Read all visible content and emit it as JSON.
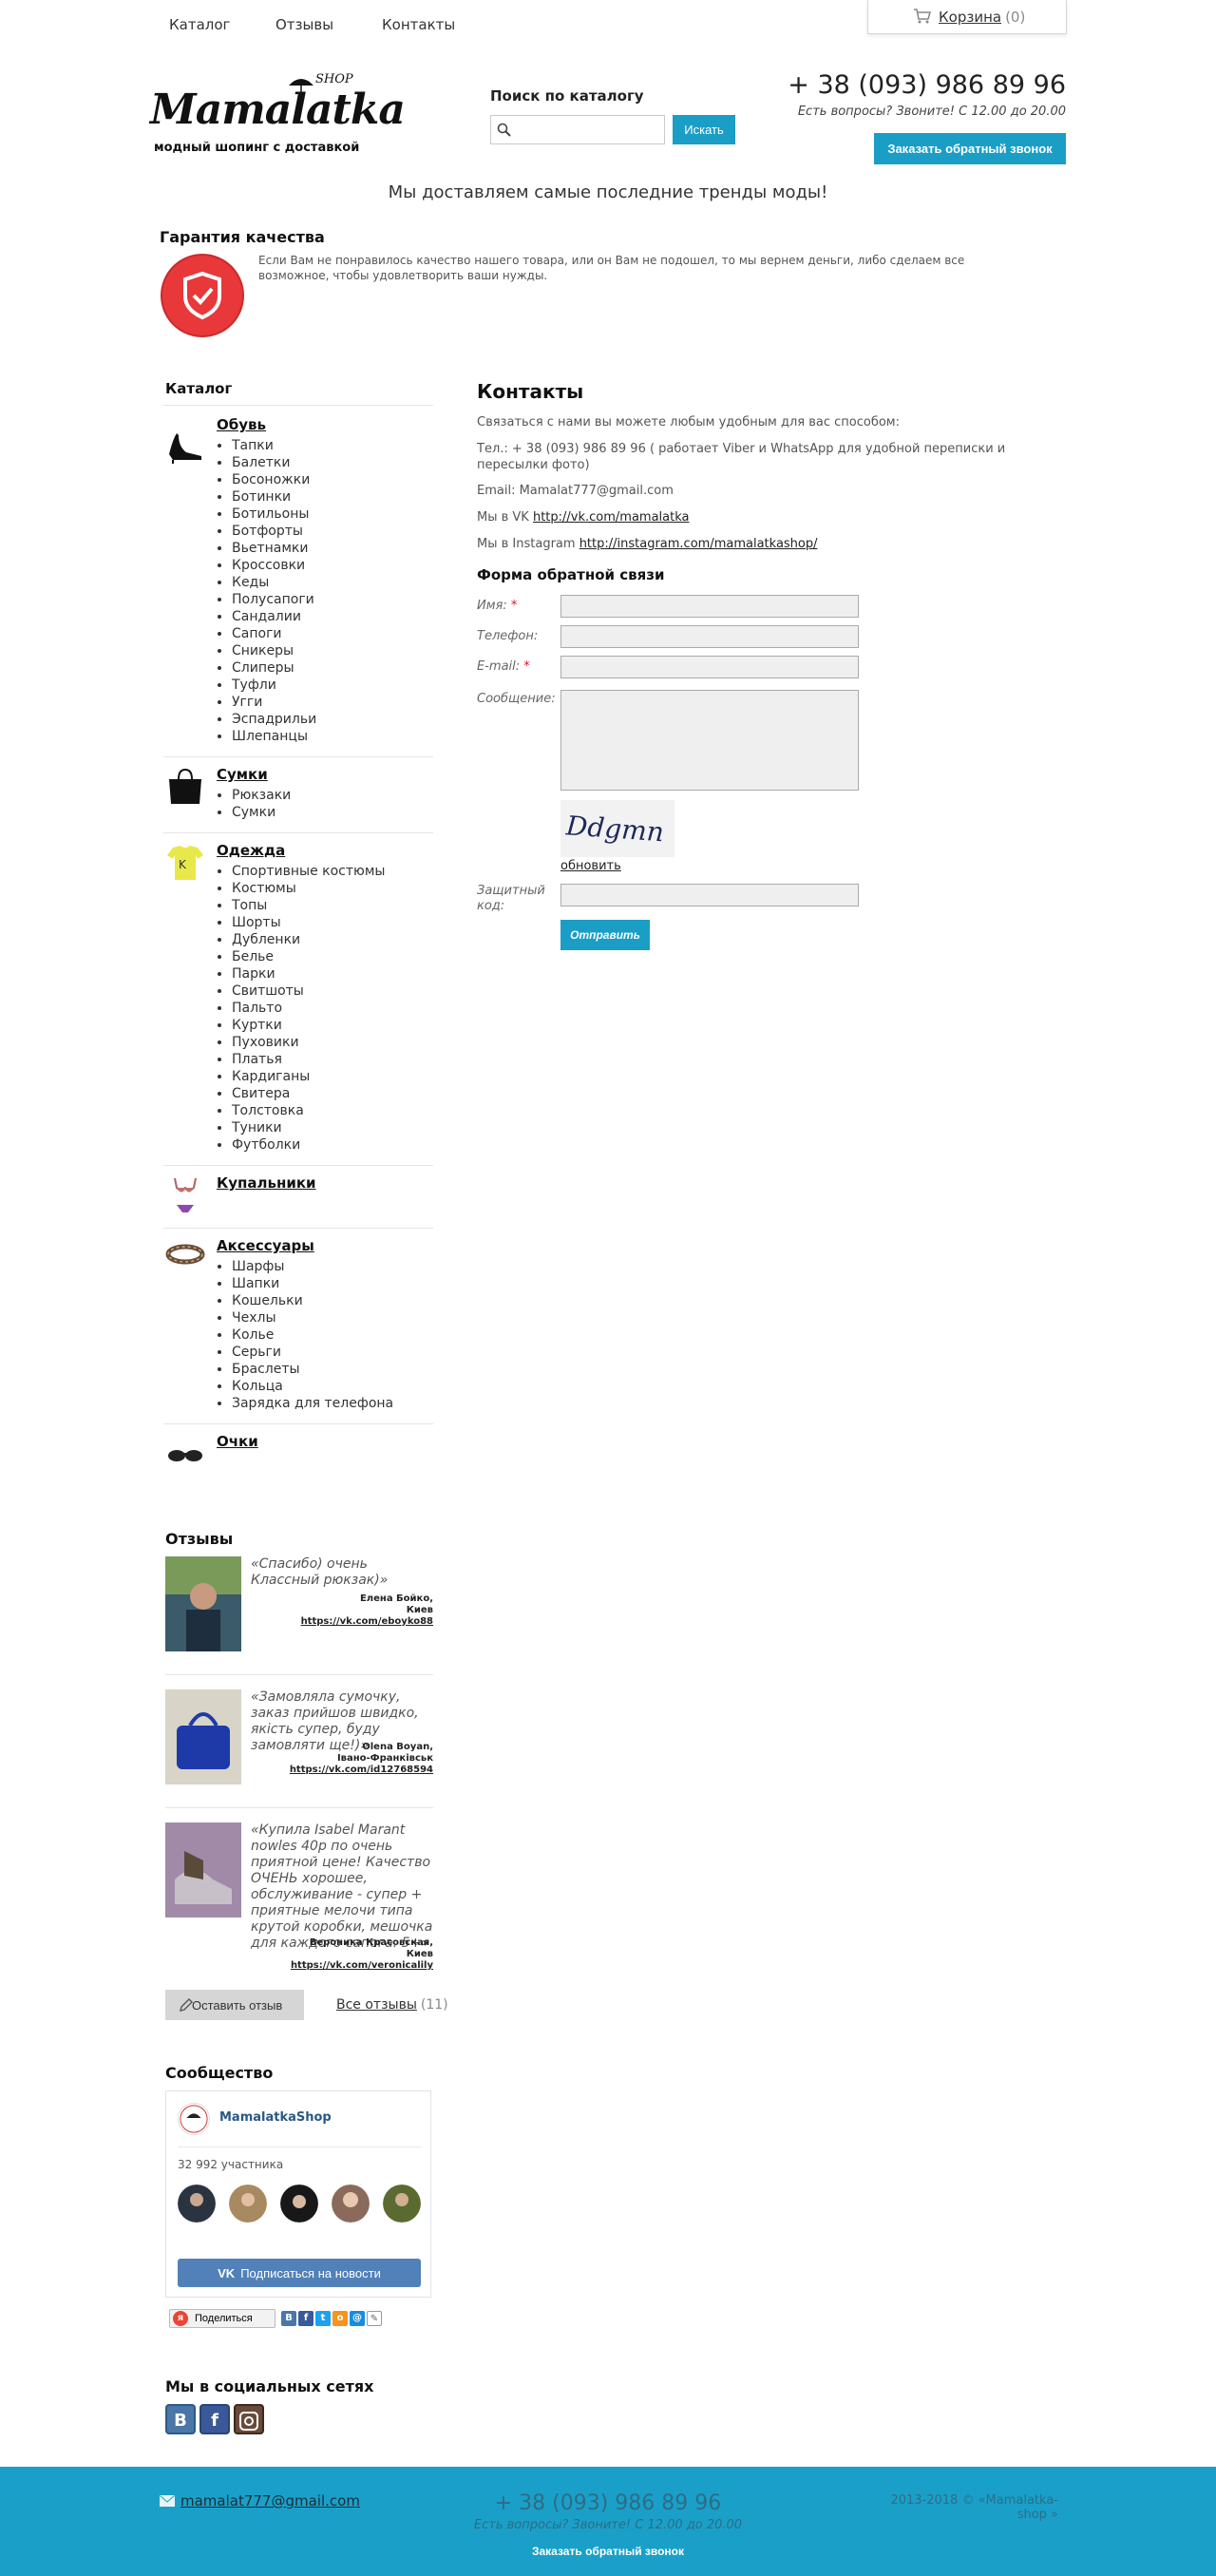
{
  "topnav": {
    "items": [
      "Каталог",
      "Отзывы",
      "Контакты"
    ],
    "cart_label": "Корзина",
    "cart_count": "(0)"
  },
  "header": {
    "logo_word": "Mamalatka",
    "logo_shop": "SHOP",
    "logo_tagline": "модный шопинг с доставкой",
    "search_title": "Поиск по каталогу",
    "search_value": "",
    "search_button": "Искать",
    "phone": "+ 38 (093) 986 89 96",
    "phone_note": "Есть вопросы? Звоните! С 12.00 до 20.00",
    "callback_button": "Заказать обратный звонок",
    "tagline": "Мы доставляем самые последние тренды моды!"
  },
  "guarantee": {
    "title": "Гарантия качества",
    "text": "Если Вам не понравилось качество нашего товара, или он Вам не подошел, то мы вернем деньги, либо сделаем все возможное, чтобы удовлетворить ваши нужды."
  },
  "sidebar": {
    "catalog_title": "Каталог",
    "categories": [
      {
        "name": "Обувь",
        "thumb": "shoe-icon",
        "items": [
          "Тапки",
          "Балетки",
          "Босоножки",
          "Ботинки",
          "Ботильоны",
          "Ботфорты",
          "Вьетнамки",
          "Кроссовки",
          "Кеды",
          "Полусапоги",
          "Сандалии",
          "Сапоги",
          "Сникеры",
          "Слиперы",
          "Туфли",
          "Угги",
          "Эспадрильи",
          "Шлепанцы"
        ]
      },
      {
        "name": "Сумки",
        "thumb": "bag-icon",
        "items": [
          "Рюкзаки",
          "Сумки"
        ]
      },
      {
        "name": "Одежда",
        "thumb": "tshirt-icon",
        "items": [
          "Спортивные костюмы",
          "Костюмы",
          "Топы",
          "Шорты",
          "Дубленки",
          "Белье",
          "Парки",
          "Свитшоты",
          "Пальто",
          "Куртки",
          "Пуховики",
          "Платья",
          "Кардиганы",
          "Свитера",
          "Толстовка",
          "Туники",
          "Футболки"
        ]
      },
      {
        "name": "Купальники",
        "thumb": "swimsuit-icon",
        "items": []
      },
      {
        "name": "Аксессуары",
        "thumb": "bracelet-icon",
        "items": [
          "Шарфы",
          "Шапки",
          "Кошельки",
          "Чехлы",
          "Колье",
          "Серьги",
          "Браслеты",
          "Кольца",
          "Зарядка для телефона"
        ]
      },
      {
        "name": "Очки",
        "thumb": "sunglasses-icon",
        "items": []
      }
    ],
    "reviews_title": "Отзывы",
    "reviews": [
      {
        "quote": "«Спасибо) очень Классный рюкзак)»",
        "author_1": "Елена Бойко,",
        "author_2": "Киев",
        "link": "https://vk.com/eboyko88"
      },
      {
        "quote": "«Замовляла сумочку, заказ прийшов швидко, якість супер, буду замовляти ще!)»",
        "author_1": "Olena Boyan,",
        "author_2": "Івано-Франківськ",
        "link": "https://vk.com/id12768594"
      },
      {
        "quote": "«Купила Isabel Marant nowles 40р по очень приятной цене! Качество ОЧЕНЬ хорошее, обслуживание - супер + приятные мелочи типа крутой коробки, мешочка для каждого сапога. 5+»",
        "author_1": "Вероника Красовская,",
        "author_2": "Киев",
        "link": "https://vk.com/veronicalily"
      }
    ],
    "leave_review": "Оставить отзыв",
    "all_reviews": "Все отзывы",
    "all_reviews_count": "(11)",
    "community_title": "Сообщество",
    "vk": {
      "name": "MamalatkaShop",
      "members": "32 992 участника",
      "subscribe": "Подписаться на новости"
    },
    "share_label": "Поделиться",
    "social_title": "Мы в социальных сетях"
  },
  "main": {
    "title": "Контакты",
    "intro": "Связаться с нами вы можете любым удобным для вас способом:",
    "phone_line": "Тел.: + 38 (093) 986 89 96 ( работает Viber и WhatsApp для удобной переписки и пересылки фото)",
    "email_line": "Email: Mamalat777@gmail.com",
    "vk_prefix": "Мы в VK",
    "vk_link": "http://vk.com/mamalatka",
    "ig_prefix": "Мы в Instagram",
    "ig_link": "http://instagram.com/mamalatkashop/",
    "form_title": "Форма обратной связи",
    "labels": {
      "name": "Имя:",
      "phone": "Телефон:",
      "email": "E-mail:",
      "message": "Сообщение:",
      "code_1": "Защитный",
      "code_2": "код:"
    },
    "required_mark": "*",
    "captcha_text": "Ddgmn",
    "refresh": "обновить",
    "send": "Отправить"
  },
  "footer": {
    "email": "mamalat777@gmail.com",
    "phone": "+ 38 (093) 986 89 96",
    "note": "Есть вопросы? Звоните! С 12.00 до 20.00",
    "copyright": "2013-2018 © «Mamalatka-shop »",
    "callback": "Заказать обратный звонок"
  },
  "colors": {
    "accent": "#1a9ec6",
    "footer": "#1aa0c8",
    "vk": "#5181b8"
  }
}
